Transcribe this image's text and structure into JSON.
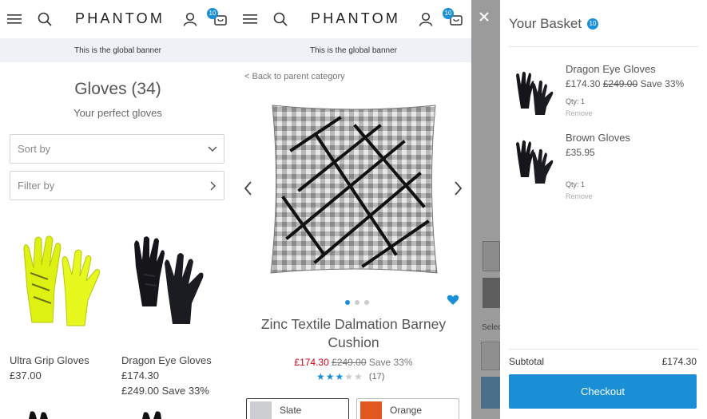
{
  "brand": {
    "logo": "PHANTOM",
    "basket_count": "10",
    "accent": "#1a8fd6",
    "sale_color": "#d0021b"
  },
  "banner": {
    "text": "This is the global banner"
  },
  "category": {
    "title": "Gloves (34)",
    "subtitle": "Your perfect gloves",
    "sort_label": "Sort by",
    "filter_label": "Filter by",
    "products": [
      {
        "name": "Ultra Grip Gloves",
        "price": "£37.00",
        "was": "",
        "image": "neon-yellow-glove"
      },
      {
        "name": "Dragon Eye Gloves",
        "price": "£174.30",
        "was": "£249.00 Save 33%",
        "image": "black-glove"
      }
    ]
  },
  "product": {
    "back_label": "< Back to parent category",
    "name_line1": "Zinc Textile Dalmation Barney",
    "name_line2": "Cushion",
    "price_now": "£174.30",
    "price_was": "£249.00",
    "price_save": "Save 33%",
    "rating": 3,
    "rating_max": 5,
    "reviews": "(17)",
    "image": "patterned-cushion",
    "gallery_position": 1,
    "gallery_total": 3,
    "swatches": [
      {
        "label": "Slate",
        "color": "#ccced1",
        "selected": true
      },
      {
        "label": "Orange",
        "color": "#e2571d",
        "selected": false
      }
    ]
  },
  "basket": {
    "title": "Your Basket",
    "count": "10",
    "items": [
      {
        "name": "Dragon Eye Gloves",
        "price": "£174.30",
        "was": "£249.00",
        "save": "Save 33%",
        "qty": "Qty: 1",
        "remove": "Remove"
      },
      {
        "name": "Brown Gloves",
        "price": "£35.95",
        "was": "",
        "save": "",
        "qty": "Qty: 1",
        "remove": "Remove"
      }
    ],
    "subtotal_label": "Subtotal",
    "subtotal_value": "£174.30",
    "checkout_label": "Checkout",
    "background_text": "Selec"
  }
}
